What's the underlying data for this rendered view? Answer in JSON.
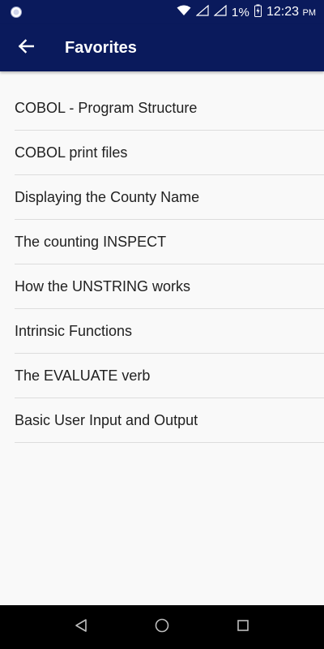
{
  "status_bar": {
    "battery_percent": "1%",
    "time": "12:23",
    "time_suffix": "PM"
  },
  "app_bar": {
    "title": "Favorites",
    "back_icon": "arrow-back-icon",
    "background": "#0a1a5c"
  },
  "favorites": [
    {
      "label": "COBOL - Program Structure"
    },
    {
      "label": "COBOL print files"
    },
    {
      "label": "Displaying the County Name"
    },
    {
      "label": "The counting INSPECT"
    },
    {
      "label": "How the UNSTRING works"
    },
    {
      "label": "Intrinsic Functions"
    },
    {
      "label": "The EVALUATE verb"
    },
    {
      "label": "Basic User Input and Output"
    }
  ],
  "nav_bar": {
    "back": "nav-back-icon",
    "home": "nav-home-icon",
    "recents": "nav-recents-icon"
  }
}
